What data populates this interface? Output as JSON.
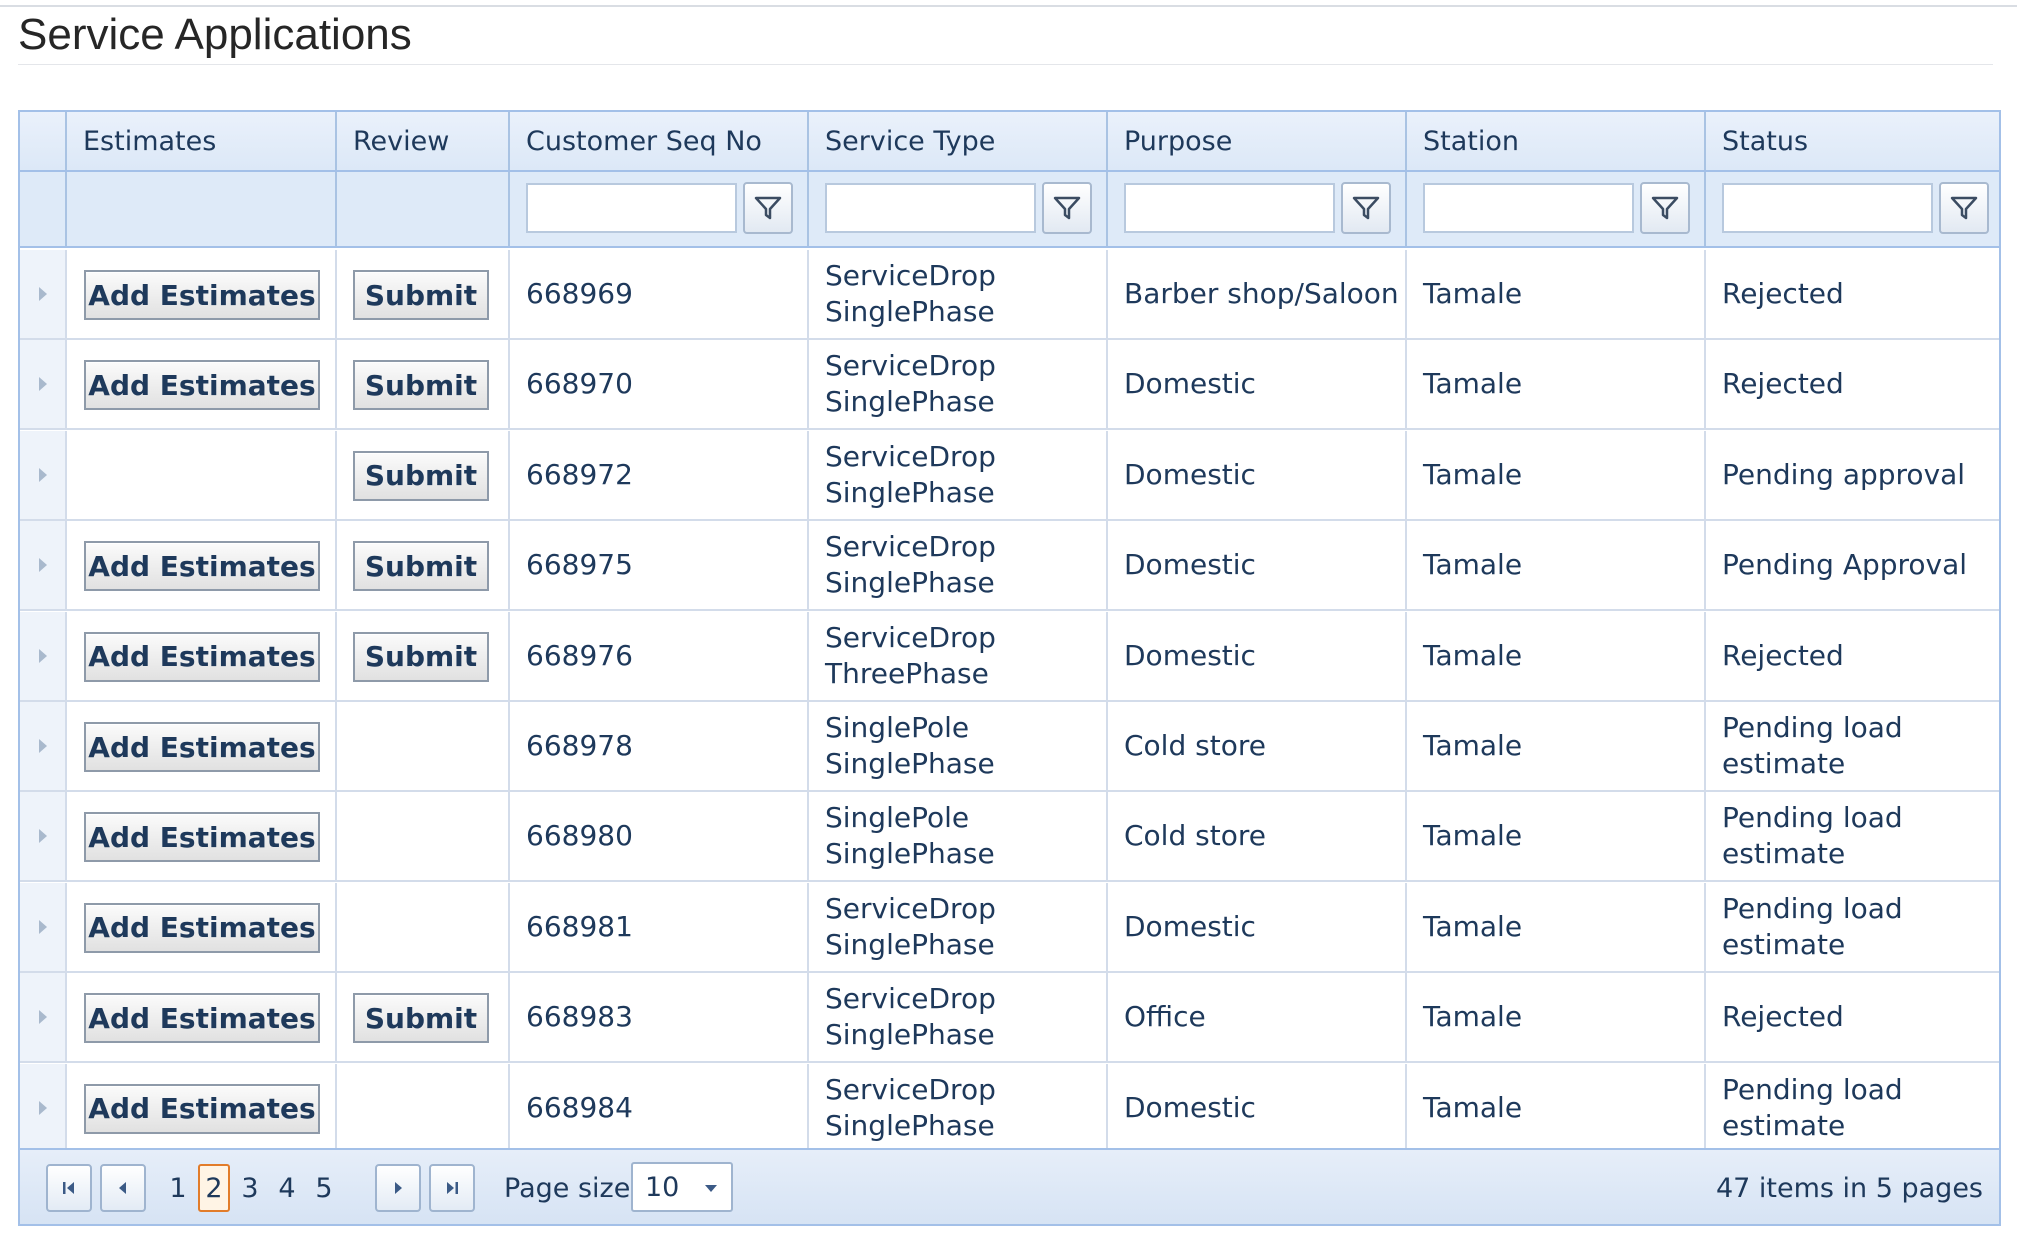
{
  "page": {
    "title": "Service Applications"
  },
  "grid": {
    "columns": [
      "",
      "Estimates",
      "Review",
      "Customer Seq No",
      "Service Type",
      "Purpose",
      "Station",
      "Status"
    ],
    "rows": [
      {
        "estimates": "Add Estimates",
        "review": "Submit",
        "seq": "668969",
        "service_line1": "ServiceDrop",
        "service_line2": "SinglePhase",
        "purpose": "Barber shop/Saloon",
        "station": "Tamale",
        "status_line1": "Rejected",
        "status_line2": ""
      },
      {
        "estimates": "Add Estimates",
        "review": "Submit",
        "seq": "668970",
        "service_line1": "ServiceDrop",
        "service_line2": "SinglePhase",
        "purpose": "Domestic",
        "station": "Tamale",
        "status_line1": "Rejected",
        "status_line2": ""
      },
      {
        "estimates": "",
        "review": "Submit",
        "seq": "668972",
        "service_line1": "ServiceDrop",
        "service_line2": "SinglePhase",
        "purpose": "Domestic",
        "station": "Tamale",
        "status_line1": "Pending approval",
        "status_line2": ""
      },
      {
        "estimates": "Add Estimates",
        "review": "Submit",
        "seq": "668975",
        "service_line1": "ServiceDrop",
        "service_line2": "SinglePhase",
        "purpose": "Domestic",
        "station": "Tamale",
        "status_line1": "Pending Approval",
        "status_line2": ""
      },
      {
        "estimates": "Add Estimates",
        "review": "Submit",
        "seq": "668976",
        "service_line1": "ServiceDrop",
        "service_line2": "ThreePhase",
        "purpose": "Domestic",
        "station": "Tamale",
        "status_line1": "Rejected",
        "status_line2": ""
      },
      {
        "estimates": "Add Estimates",
        "review": "",
        "seq": "668978",
        "service_line1": "SinglePole",
        "service_line2": "SinglePhase",
        "purpose": "Cold store",
        "station": "Tamale",
        "status_line1": "Pending load",
        "status_line2": "estimate"
      },
      {
        "estimates": "Add Estimates",
        "review": "",
        "seq": "668980",
        "service_line1": "SinglePole",
        "service_line2": "SinglePhase",
        "purpose": "Cold store",
        "station": "Tamale",
        "status_line1": "Pending load",
        "status_line2": "estimate"
      },
      {
        "estimates": "Add Estimates",
        "review": "",
        "seq": "668981",
        "service_line1": "ServiceDrop",
        "service_line2": "SinglePhase",
        "purpose": "Domestic",
        "station": "Tamale",
        "status_line1": "Pending load",
        "status_line2": "estimate"
      },
      {
        "estimates": "Add Estimates",
        "review": "Submit",
        "seq": "668983",
        "service_line1": "ServiceDrop",
        "service_line2": "SinglePhase",
        "purpose": "Office",
        "station": "Tamale",
        "status_line1": "Rejected",
        "status_line2": ""
      },
      {
        "estimates": "Add Estimates",
        "review": "",
        "seq": "668984",
        "service_line1": "ServiceDrop",
        "service_line2": "SinglePhase",
        "purpose": "Domestic",
        "station": "Tamale",
        "status_line1": "Pending load",
        "status_line2": "estimate"
      }
    ]
  },
  "pager": {
    "pages": [
      "1",
      "2",
      "3",
      "4",
      "5"
    ],
    "current_page": "2",
    "page_size_label": "Page size:",
    "page_size": "10",
    "info": "47 items in 5 pages"
  },
  "icons": {
    "filter": "filter-icon",
    "expand": "expand-arrow-icon",
    "first": "first-page-icon",
    "prev": "prev-page-icon",
    "next": "next-page-icon",
    "last": "last-page-icon",
    "dropdown": "chevron-down-icon"
  },
  "colors": {
    "header_bg": "#dce8f7",
    "border": "#a3c0e8",
    "text": "#1e395b",
    "current_page_border": "#e27c2a"
  }
}
